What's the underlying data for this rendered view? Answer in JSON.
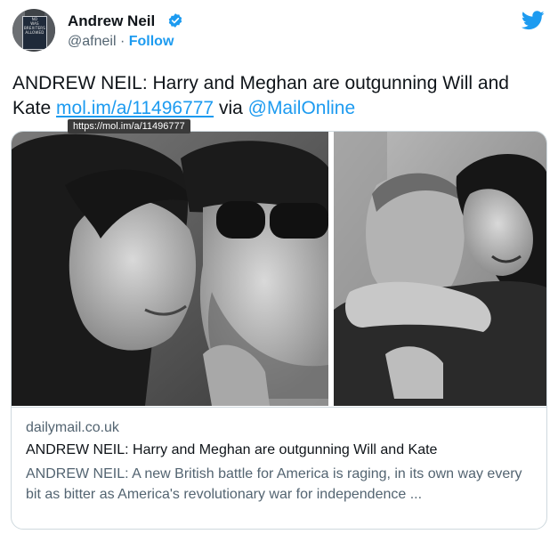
{
  "author": {
    "name": "Andrew Neil",
    "handle": "@afneil",
    "separator": "·",
    "follow_label": "Follow",
    "avatar_sign_lines": [
      "NO",
      "WAS",
      "BREXITERS",
      "ALLOWED"
    ]
  },
  "tweet": {
    "text_prefix": "ANDREW NEIL: Harry and Meghan are outgunning Will and Kate ",
    "link_text": "mol.im/a/11496777",
    "text_via": " via ",
    "mention": "@MailOnline"
  },
  "tooltip": {
    "text": "https://mol.im/a/11496777"
  },
  "card": {
    "domain": "dailymail.co.uk",
    "title": "ANDREW NEIL: Harry and Meghan are outgunning Will and Kate",
    "description": "ANDREW NEIL: A new British battle for America is raging, in its own way every bit as bitter as America's revolutionary war for independence ..."
  },
  "colors": {
    "accent": "#1d9bf0",
    "text": "#0f1419",
    "muted": "#536471",
    "border": "#cfd9de"
  },
  "icons": {
    "verified": "verified-badge-icon",
    "brand": "twitter-bird-icon"
  }
}
